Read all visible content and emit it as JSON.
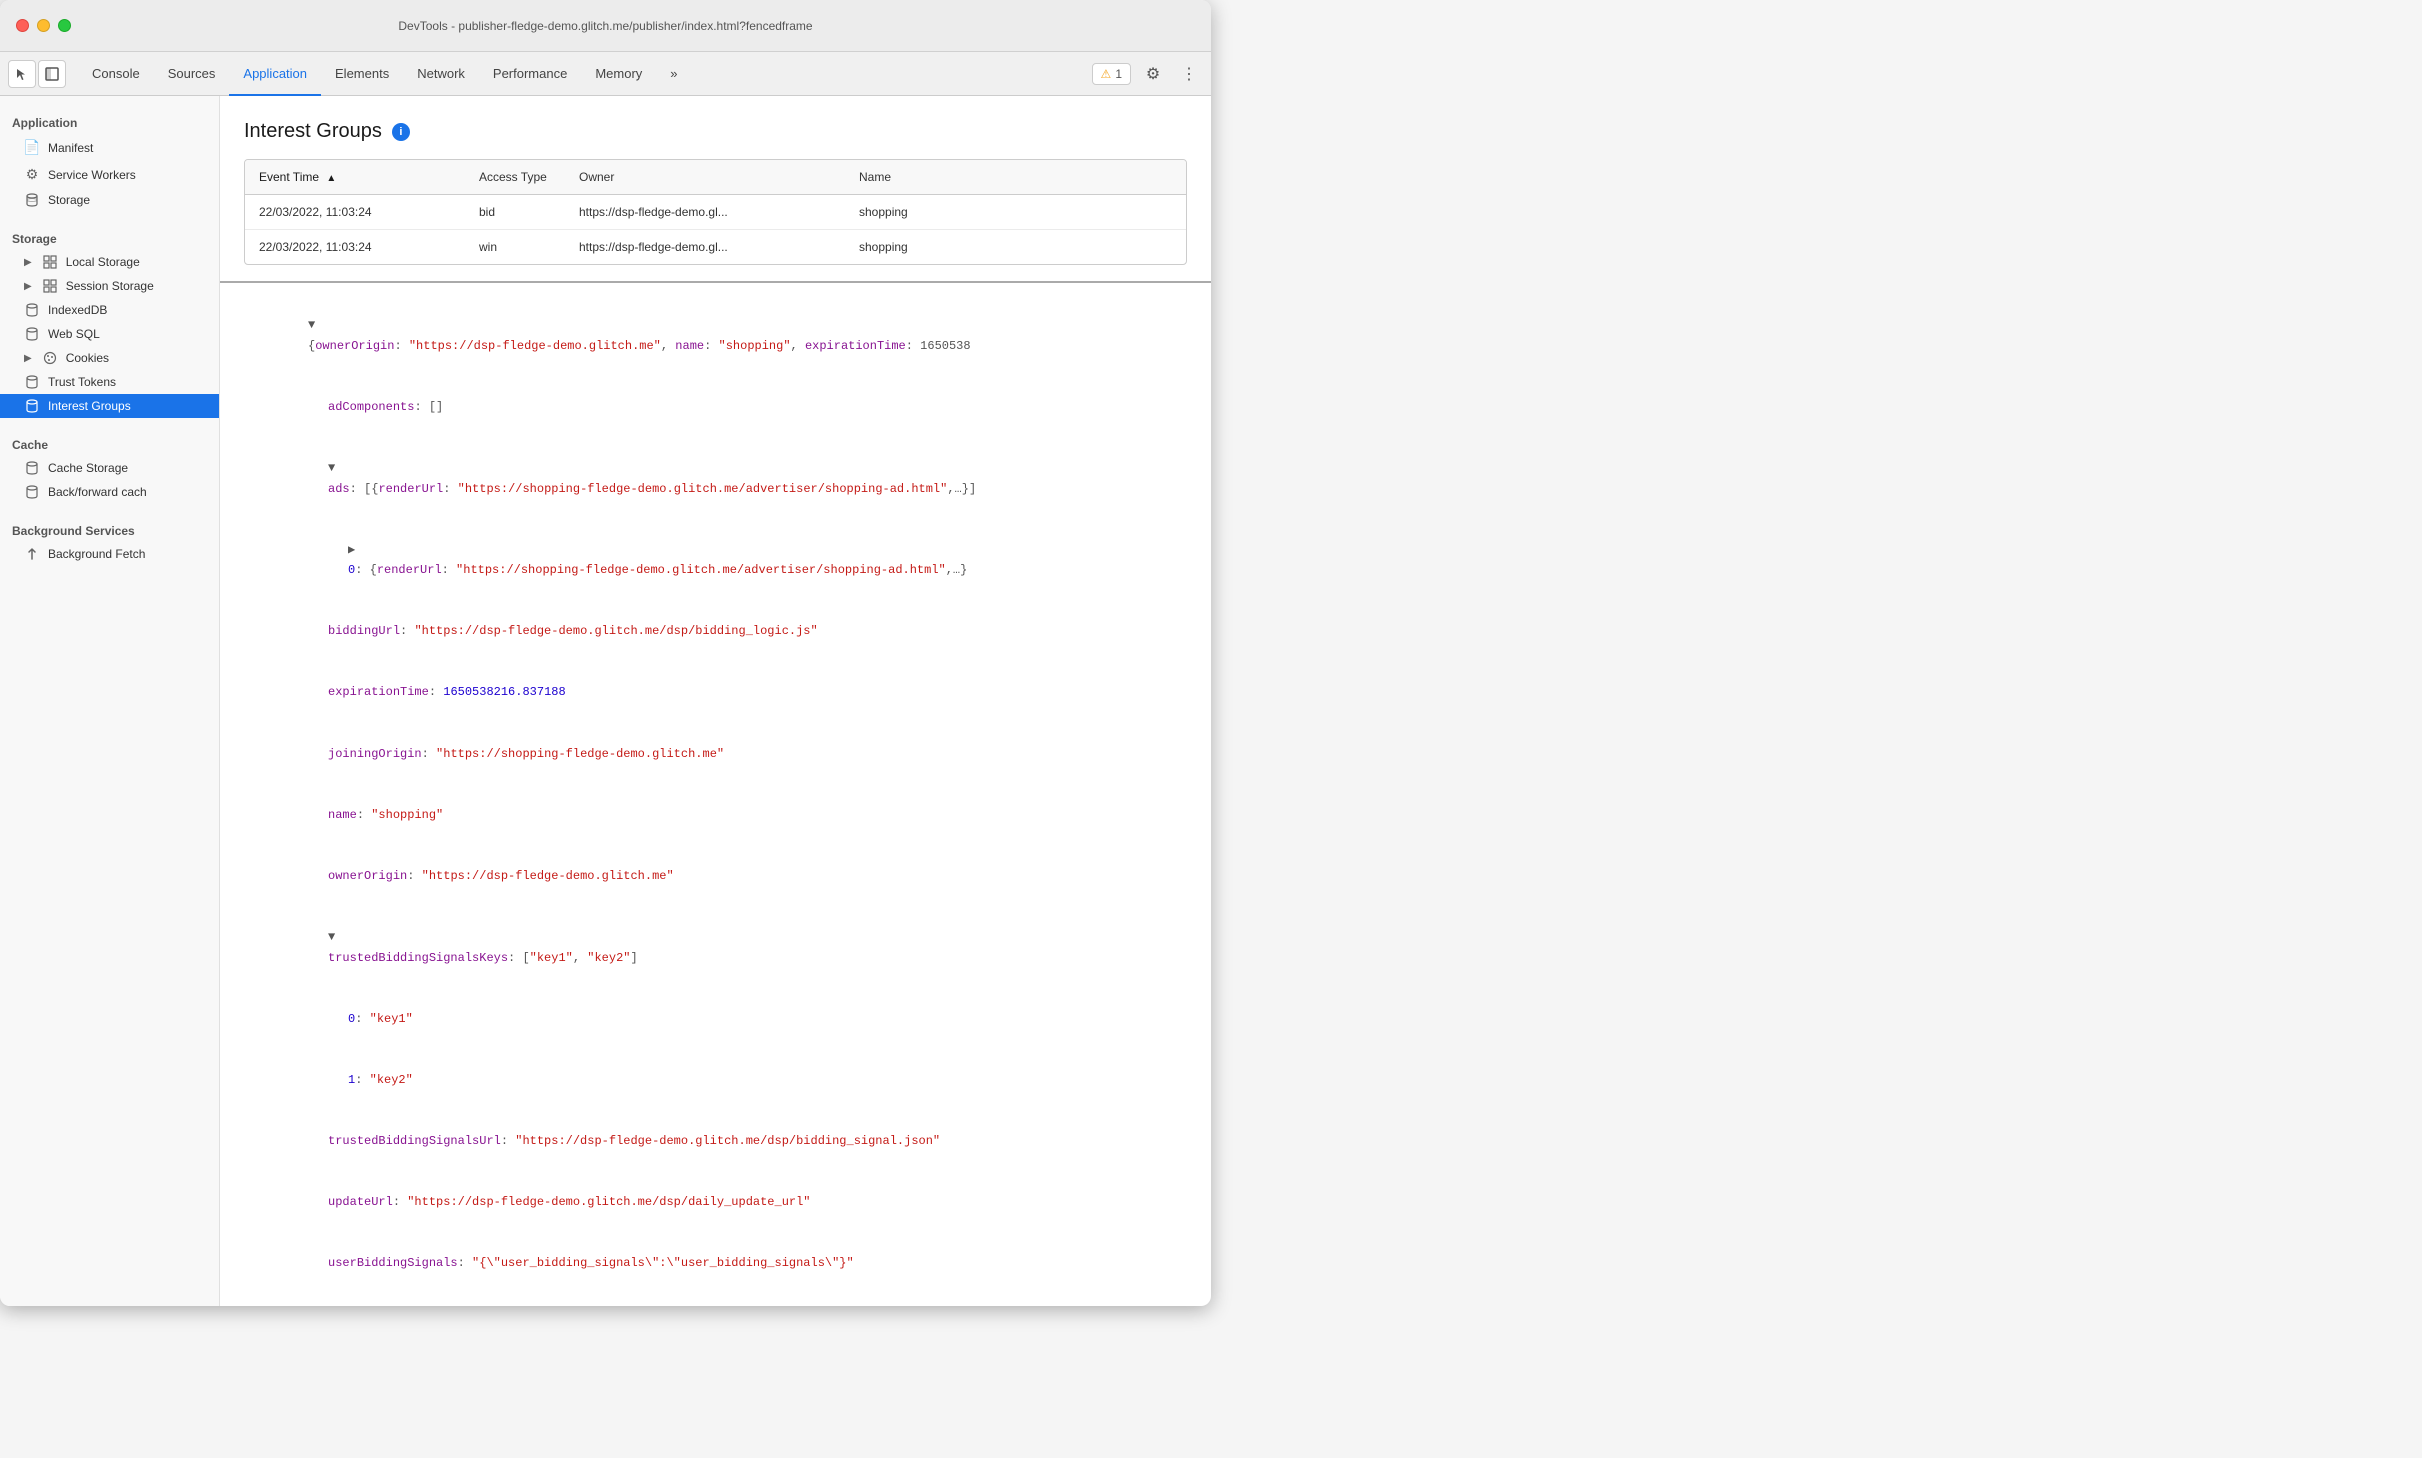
{
  "window": {
    "title": "DevTools - publisher-fledge-demo.glitch.me/publisher/index.html?fencedframe"
  },
  "toolbar": {
    "tabs": [
      {
        "id": "console",
        "label": "Console",
        "active": false
      },
      {
        "id": "sources",
        "label": "Sources",
        "active": false
      },
      {
        "id": "application",
        "label": "Application",
        "active": true
      },
      {
        "id": "elements",
        "label": "Elements",
        "active": false
      },
      {
        "id": "network",
        "label": "Network",
        "active": false
      },
      {
        "id": "performance",
        "label": "Performance",
        "active": false
      },
      {
        "id": "memory",
        "label": "Memory",
        "active": false
      }
    ],
    "more_label": "»",
    "warning_count": "1",
    "settings_icon": "⚙",
    "more_icon": "⋮"
  },
  "sidebar": {
    "sections": [
      {
        "id": "application",
        "label": "Application",
        "items": [
          {
            "id": "manifest",
            "label": "Manifest",
            "icon": "doc",
            "indent": 1
          },
          {
            "id": "service-workers",
            "label": "Service Workers",
            "icon": "gear",
            "indent": 1
          },
          {
            "id": "storage",
            "label": "Storage",
            "icon": "db",
            "indent": 1
          }
        ]
      },
      {
        "id": "storage",
        "label": "Storage",
        "items": [
          {
            "id": "local-storage",
            "label": "Local Storage",
            "icon": "grid",
            "indent": 1,
            "expandable": true
          },
          {
            "id": "session-storage",
            "label": "Session Storage",
            "icon": "grid",
            "indent": 1,
            "expandable": true
          },
          {
            "id": "indexeddb",
            "label": "IndexedDB",
            "icon": "db",
            "indent": 1
          },
          {
            "id": "web-sql",
            "label": "Web SQL",
            "icon": "db",
            "indent": 1
          },
          {
            "id": "cookies",
            "label": "Cookies",
            "icon": "cookie",
            "indent": 1,
            "expandable": true
          },
          {
            "id": "trust-tokens",
            "label": "Trust Tokens",
            "icon": "db",
            "indent": 1
          },
          {
            "id": "interest-groups",
            "label": "Interest Groups",
            "icon": "db",
            "indent": 1,
            "active": true
          }
        ]
      },
      {
        "id": "cache",
        "label": "Cache",
        "items": [
          {
            "id": "cache-storage",
            "label": "Cache Storage",
            "icon": "db",
            "indent": 1
          },
          {
            "id": "back-forward-cache",
            "label": "Back/forward cach",
            "icon": "db",
            "indent": 1
          }
        ]
      },
      {
        "id": "background-services",
        "label": "Background Services",
        "items": [
          {
            "id": "background-fetch",
            "label": "Background Fetch",
            "icon": "arrow-up",
            "indent": 1
          }
        ]
      }
    ]
  },
  "content": {
    "title": "Interest Groups",
    "table": {
      "columns": [
        {
          "id": "event_time",
          "label": "Event Time",
          "sorted": true
        },
        {
          "id": "access_type",
          "label": "Access Type"
        },
        {
          "id": "owner",
          "label": "Owner"
        },
        {
          "id": "name",
          "label": "Name"
        }
      ],
      "rows": [
        {
          "event_time": "22/03/2022, 11:03:24",
          "access_type": "bid",
          "owner": "https://dsp-fledge-demo.gl...",
          "name": "shopping"
        },
        {
          "event_time": "22/03/2022, 11:03:24",
          "access_type": "win",
          "owner": "https://dsp-fledge-demo.gl...",
          "name": "shopping"
        }
      ]
    },
    "detail": {
      "lines": [
        {
          "indent": 0,
          "type": "object-start",
          "text": "{ownerOrigin: \"https://dsp-fledge-demo.glitch.me\", name: \"shopping\", expirationTime: 1650538"
        },
        {
          "indent": 1,
          "type": "key-val",
          "key": "adComponents",
          "value": "[]"
        },
        {
          "indent": 1,
          "type": "array-start",
          "key": "ads",
          "value": "[{renderUrl: \"https://shopping-fledge-demo.glitch.me/advertiser/shopping-ad.html\",…}]"
        },
        {
          "indent": 2,
          "type": "object-row",
          "key": "0",
          "value": "{renderUrl: \"https://shopping-fledge-demo.glitch.me/advertiser/shopping-ad.html\",…}"
        },
        {
          "indent": 1,
          "type": "key-url",
          "key": "biddingUrl",
          "value": "\"https://dsp-fledge-demo.glitch.me/dsp/bidding_logic.js\""
        },
        {
          "indent": 1,
          "type": "key-num",
          "key": "expirationTime",
          "value": "1650538216.837188"
        },
        {
          "indent": 1,
          "type": "key-url",
          "key": "joiningOrigin",
          "value": "\"https://shopping-fledge-demo.glitch.me\""
        },
        {
          "indent": 1,
          "type": "key-str",
          "key": "name",
          "value": "\"shopping\""
        },
        {
          "indent": 1,
          "type": "key-url",
          "key": "ownerOrigin",
          "value": "\"https://dsp-fledge-demo.glitch.me\""
        },
        {
          "indent": 1,
          "type": "array-keys",
          "key": "trustedBiddingSignalsKeys",
          "value": "[\"key1\", \"key2\"]"
        },
        {
          "indent": 2,
          "type": "key-str",
          "key": "0",
          "value": "\"key1\""
        },
        {
          "indent": 2,
          "type": "key-str",
          "key": "1",
          "value": "\"key2\""
        },
        {
          "indent": 1,
          "type": "key-url",
          "key": "trustedBiddingSignalsUrl",
          "value": "\"https://dsp-fledge-demo.glitch.me/dsp/bidding_signal.json\""
        },
        {
          "indent": 1,
          "type": "key-url",
          "key": "updateUrl",
          "value": "\"https://dsp-fledge-demo.glitch.me/dsp/daily_update_url\""
        },
        {
          "indent": 1,
          "type": "key-str",
          "key": "userBiddingSignals",
          "value": "\"{\\\"user_bidding_signals\\\":\\\"user_bidding_signals\\\"}\""
        }
      ]
    }
  }
}
